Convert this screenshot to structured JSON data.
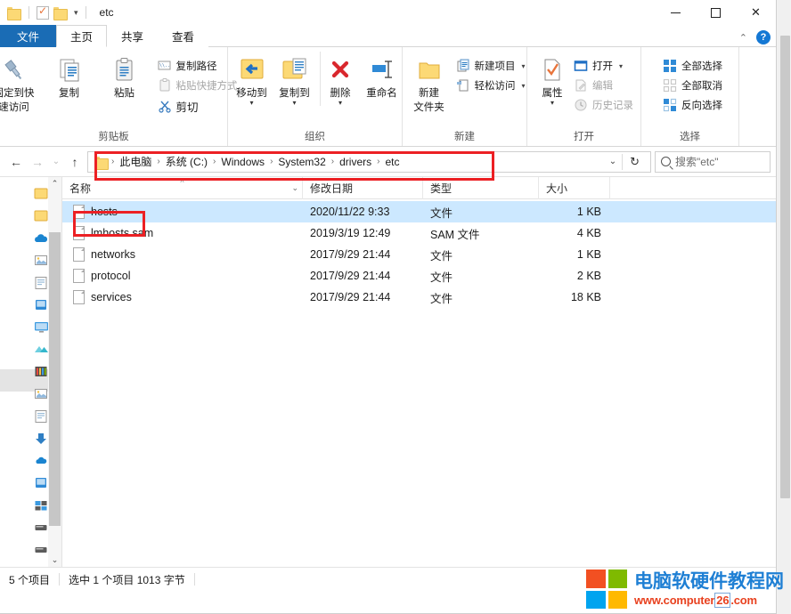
{
  "window": {
    "title": "etc",
    "quick_access": [
      "folder-icon",
      "properties-icon",
      "new-folder-icon"
    ],
    "qat_caret": "▾",
    "controls": {
      "minimize": "minimize-icon",
      "maximize": "maximize-icon",
      "close": "✕"
    }
  },
  "tabs": [
    {
      "id": "file",
      "label": "文件"
    },
    {
      "id": "home",
      "label": "主页"
    },
    {
      "id": "share",
      "label": "共享"
    },
    {
      "id": "view",
      "label": "查看"
    }
  ],
  "ribbon": {
    "collapse_caret": "⌃",
    "help": "?",
    "groups": [
      {
        "name": "剪贴板",
        "big": [
          {
            "label_line1": "固定到快",
            "label_line2": "速访问",
            "icon": "pin-icon"
          },
          {
            "label_line1": "复制",
            "label_line2": "",
            "icon": "copy-icon"
          },
          {
            "label_line1": "粘贴",
            "label_line2": "",
            "icon": "paste-icon"
          }
        ],
        "small": [
          {
            "label": "复制路径",
            "icon": "copy-path-icon",
            "disabled": false
          },
          {
            "label": "粘贴快捷方式",
            "icon": "paste-shortcut-icon",
            "disabled": true
          },
          {
            "label": "剪切",
            "icon": "scissors-icon",
            "disabled": false
          }
        ]
      },
      {
        "name": "组织",
        "big": [
          {
            "label_line1": "移动到",
            "label_line2": "",
            "icon": "move-to-icon",
            "caret": "▾"
          },
          {
            "label_line1": "复制到",
            "label_line2": "",
            "icon": "copy-to-icon",
            "caret": "▾"
          },
          {
            "label_line1": "删除",
            "label_line2": "",
            "icon": "delete-icon",
            "caret": "▾"
          },
          {
            "label_line1": "重命名",
            "label_line2": "",
            "icon": "rename-icon"
          }
        ],
        "small": []
      },
      {
        "name": "新建",
        "big": [
          {
            "label_line1": "新建",
            "label_line2": "文件夹",
            "icon": "new-folder-icon"
          }
        ],
        "small": [
          {
            "label": "新建项目",
            "icon": "new-item-icon",
            "caret": "▾",
            "disabled": false
          },
          {
            "label": "轻松访问",
            "icon": "easy-access-icon",
            "caret": "▾",
            "disabled": false
          }
        ]
      },
      {
        "name": "打开",
        "big": [
          {
            "label_line1": "属性",
            "label_line2": "",
            "icon": "properties-icon",
            "caret": "▾"
          }
        ],
        "small": [
          {
            "label": "打开",
            "icon": "open-icon",
            "caret": "▾",
            "disabled": false
          },
          {
            "label": "编辑",
            "icon": "edit-icon",
            "disabled": true
          },
          {
            "label": "历史记录",
            "icon": "history-icon",
            "disabled": true
          }
        ]
      },
      {
        "name": "选择",
        "big": [],
        "small": [
          {
            "label": "全部选择",
            "icon": "select-all-icon",
            "disabled": false
          },
          {
            "label": "全部取消",
            "icon": "select-none-icon",
            "disabled": true
          },
          {
            "label": "反向选择",
            "icon": "invert-selection-icon",
            "disabled": false
          }
        ]
      }
    ]
  },
  "address": {
    "back": "←",
    "forward": "→",
    "recent_caret": "⌄",
    "up": "↑",
    "folder_icon": "folder-icon",
    "separator": "›",
    "crumbs": [
      "此电脑",
      "系统 (C:)",
      "Windows",
      "System32",
      "drivers",
      "etc"
    ],
    "dropdown_caret": "⌄",
    "refresh": "↻",
    "search_placeholder": "搜索\"etc\""
  },
  "columns": [
    {
      "key": "name",
      "label": "名称",
      "sorted": true,
      "sort_arrow": "^"
    },
    {
      "key": "date",
      "label": "修改日期"
    },
    {
      "key": "type",
      "label": "类型"
    },
    {
      "key": "size",
      "label": "大小"
    }
  ],
  "files": [
    {
      "name": "hosts",
      "date": "2020/11/22 9:33",
      "type": "文件",
      "size": "1 KB",
      "selected": true
    },
    {
      "name": "lmhosts.sam",
      "date": "2019/3/19 12:49",
      "type": "SAM 文件",
      "size": "4 KB",
      "selected": false
    },
    {
      "name": "networks",
      "date": "2017/9/29 21:44",
      "type": "文件",
      "size": "1 KB",
      "selected": false
    },
    {
      "name": "protocol",
      "date": "2017/9/29 21:44",
      "type": "文件",
      "size": "2 KB",
      "selected": false
    },
    {
      "name": "services",
      "date": "2017/9/29 21:44",
      "type": "文件",
      "size": "18 KB",
      "selected": false
    }
  ],
  "status": {
    "count": "5 个项目",
    "selection": "选中 1 个项目  1013 字节"
  },
  "annotations": [
    {
      "id": "redbox-address",
      "target": "address-bar",
      "color": "#ec2024"
    },
    {
      "id": "redbox-hosts",
      "target": "hosts-file-row",
      "color": "#ec2024"
    }
  ],
  "watermark": {
    "title": "电脑软硬件教程网",
    "url_pre": "www.computer",
    "url_boxed": "26",
    "url_post": ".com"
  }
}
